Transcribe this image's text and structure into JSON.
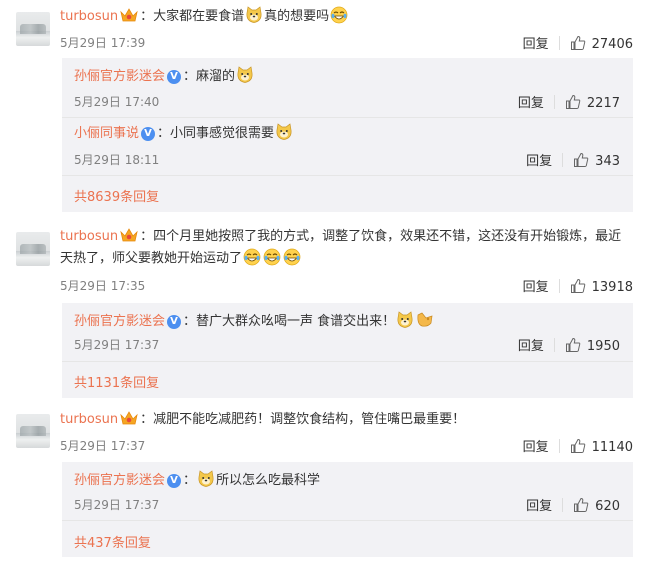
{
  "comments": [
    {
      "user": "turbosun",
      "text_a": "：大家都在要食谱",
      "text_b": "真的想要吗",
      "time": "5月29日 17:39",
      "reply_label": "回复",
      "likes": "27406",
      "replies": [
        {
          "user": "孙俪官方影迷会",
          "text_a": "：麻溜的",
          "time": "5月29日 17:40",
          "reply_label": "回复",
          "likes": "2217"
        },
        {
          "user": "小俪同事说",
          "text_a": "：小同事感觉很需要",
          "time": "5月29日 18:11",
          "reply_label": "回复",
          "likes": "343"
        }
      ],
      "more": "共8639条回复"
    },
    {
      "user": "turbosun",
      "text_a": "：四个月里她按照了我的方式，调整了饮食，效果还不错，这还没有开始锻炼，最近天热了，师父要教她开始运动了",
      "time": "5月29日 17:35",
      "reply_label": "回复",
      "likes": "13918",
      "replies": [
        {
          "user": "孙俪官方影迷会",
          "text_a": "：替广大群众吆喝一声 食谱交出来！",
          "time": "5月29日 17:37",
          "reply_label": "回复",
          "likes": "1950"
        }
      ],
      "more": "共1131条回复"
    },
    {
      "user": "turbosun",
      "text_a": "：减肥不能吃减肥药！调整饮食结构，管住嘴巴最重要！",
      "time": "5月29日 17:37",
      "reply_label": "回复",
      "likes": "11140",
      "replies": [
        {
          "user": "孙俪官方影迷会",
          "text_a": "：",
          "text_b": "所以怎么吃最科学",
          "time": "5月29日 17:37",
          "reply_label": "回复",
          "likes": "620"
        }
      ],
      "more": "共437条回复"
    }
  ],
  "icons": {
    "verified_badge": "V",
    "accent": "#eb7350",
    "verified_color": "#4c8ff0"
  }
}
